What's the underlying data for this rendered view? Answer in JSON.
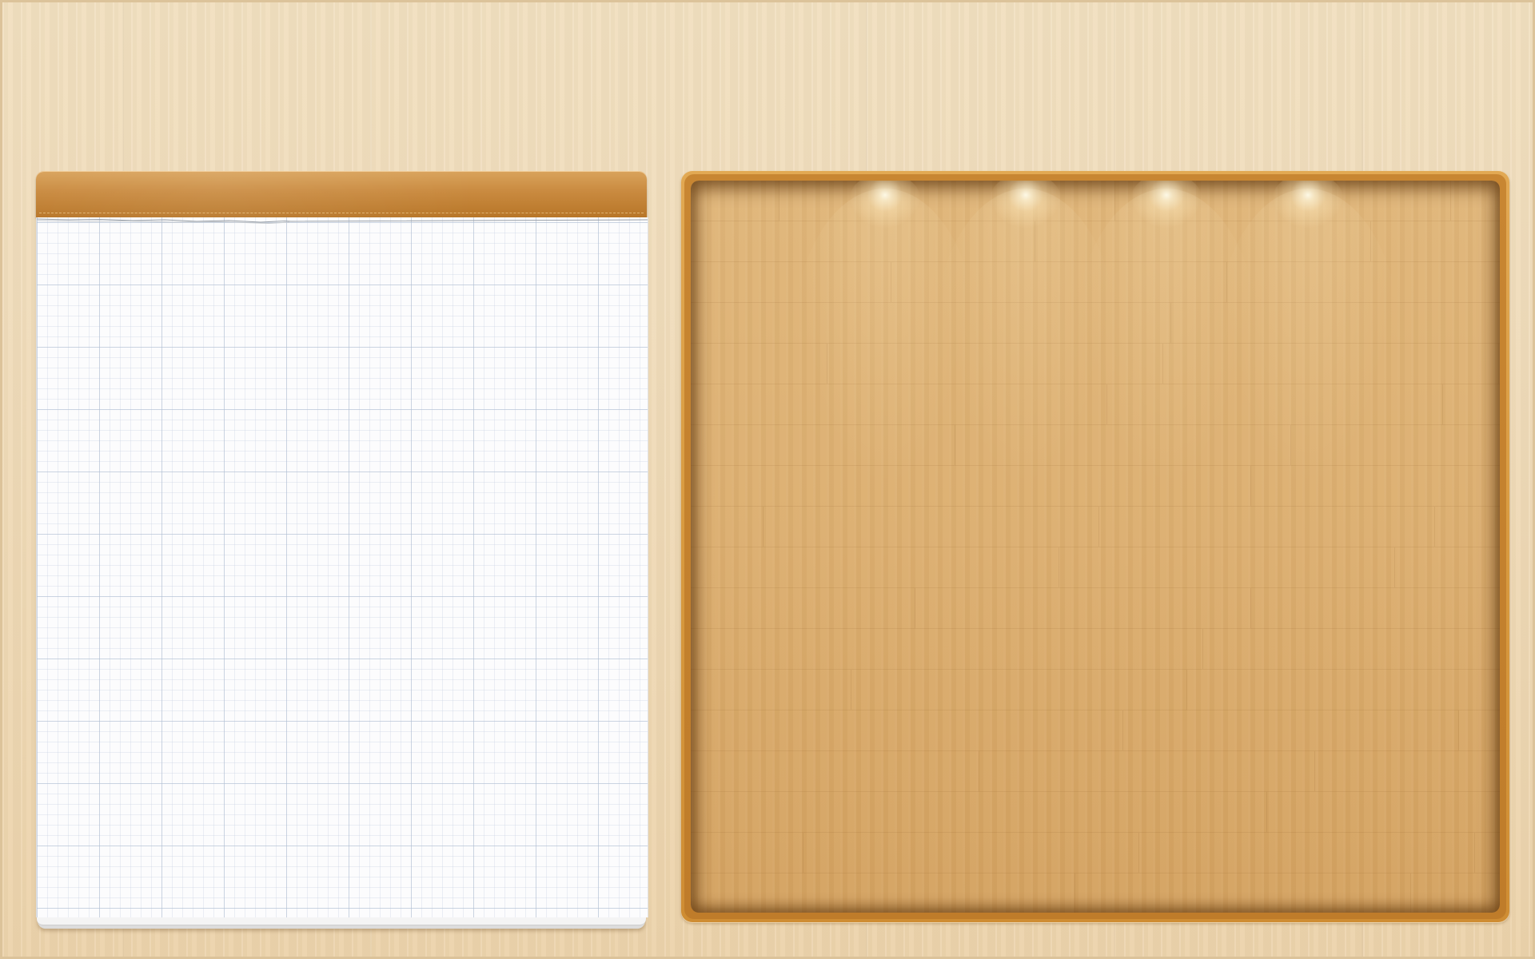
{
  "scene": {
    "background": "wooden desk",
    "desk_color": "#efd9b6",
    "notepad": {
      "binding_color": "#c98a3f",
      "paper_color": "#fcfcfd",
      "grid_line_color": "#afbed2"
    },
    "display_board": {
      "frame_color": "#d89a3f",
      "panel_color": "#dcae6f",
      "spotlights": [
        {
          "name": "spotlight-1-icon"
        },
        {
          "name": "spotlight-2-icon"
        },
        {
          "name": "spotlight-3-icon"
        },
        {
          "name": "spotlight-4-icon"
        }
      ]
    }
  }
}
